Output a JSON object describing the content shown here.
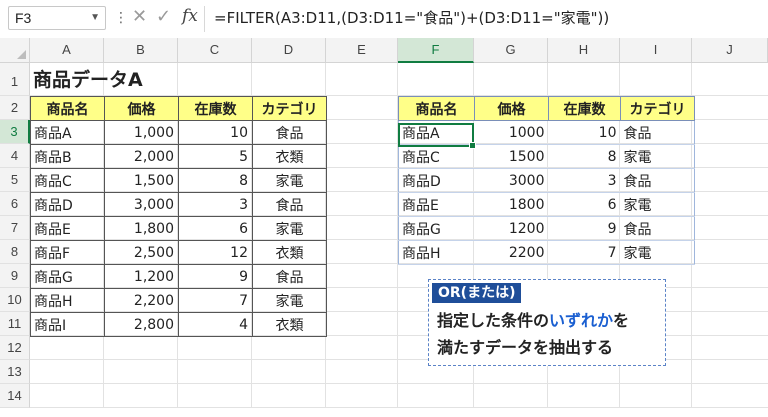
{
  "formula_bar": {
    "name_box": "F3",
    "fx_label": "fx",
    "formula": "=FILTER(A3:D11,(D3:D11=\"食品\")+(D3:D11=\"家電\"))"
  },
  "columns": [
    "A",
    "B",
    "C",
    "D",
    "E",
    "F",
    "G",
    "H",
    "I",
    "J"
  ],
  "rows": [
    "1",
    "2",
    "3",
    "4",
    "5",
    "6",
    "7",
    "8",
    "9",
    "10",
    "11",
    "12",
    "13",
    "14"
  ],
  "sheet": {
    "title": "商品データA",
    "table_a": {
      "headers": [
        "商品名",
        "価格",
        "在庫数",
        "カテゴリ"
      ],
      "rows": [
        [
          "商品A",
          "1,000",
          "10",
          "食品"
        ],
        [
          "商品B",
          "2,000",
          "5",
          "衣類"
        ],
        [
          "商品C",
          "1,500",
          "8",
          "家電"
        ],
        [
          "商品D",
          "3,000",
          "3",
          "食品"
        ],
        [
          "商品E",
          "1,800",
          "6",
          "家電"
        ],
        [
          "商品F",
          "2,500",
          "12",
          "衣類"
        ],
        [
          "商品G",
          "1,200",
          "9",
          "食品"
        ],
        [
          "商品H",
          "2,200",
          "7",
          "家電"
        ],
        [
          "商品I",
          "2,800",
          "4",
          "衣類"
        ]
      ]
    },
    "result": {
      "headers": [
        "商品名",
        "価格",
        "在庫数",
        "カテゴリ"
      ],
      "rows": [
        [
          "商品A",
          "1000",
          "10",
          "食品"
        ],
        [
          "商品C",
          "1500",
          "8",
          "家電"
        ],
        [
          "商品D",
          "3000",
          "3",
          "食品"
        ],
        [
          "商品E",
          "1800",
          "6",
          "家電"
        ],
        [
          "商品G",
          "1200",
          "9",
          "食品"
        ],
        [
          "商品H",
          "2200",
          "7",
          "家電"
        ]
      ]
    }
  },
  "note": {
    "tag": "OR(または)",
    "line1_a": "指定した条件の",
    "line1_highlight": "いずれか",
    "line1_b": "を",
    "line2": "満たすデータを抽出する"
  },
  "colors": {
    "header_fill": "#ffff88",
    "selection": "#107c41",
    "note_tag": "#1f4e99",
    "highlight": "#1a5fd1"
  }
}
